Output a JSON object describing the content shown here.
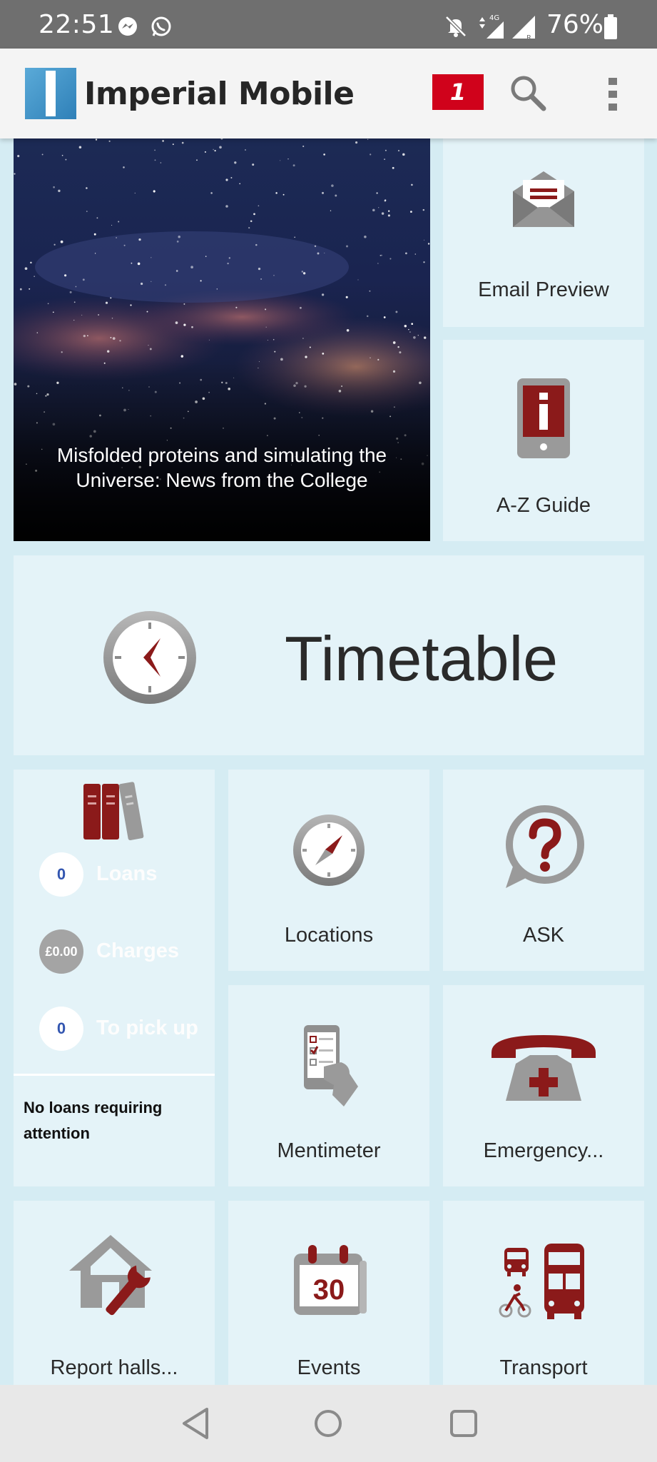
{
  "status_bar": {
    "time": "22:51",
    "battery": "76%",
    "icons": [
      "messenger-icon",
      "whatsapp-icon",
      "bell-muted-icon",
      "mobile-data-4g-icon",
      "signal-icon",
      "battery-icon"
    ]
  },
  "app_bar": {
    "title": "Imperial Mobile",
    "notification_count": "1",
    "icons": [
      "app-logo",
      "search-icon",
      "overflow-menu-icon"
    ]
  },
  "news": {
    "caption": "Misfolded proteins and simulating the Universe: News from the College"
  },
  "tiles": {
    "email_preview": "Email Preview",
    "az_guide": "A-Z Guide",
    "timetable": "Timetable",
    "locations": "Locations",
    "ask": "ASK",
    "mentimeter": "Mentimeter",
    "emergency": "Emergency...",
    "report_halls": "Report halls...",
    "events": "Events",
    "events_date": "30",
    "transport": "Transport"
  },
  "library": {
    "loans_count": "0",
    "loans_label": "Loans",
    "charges_amount": "£0.00",
    "charges_label": "Charges",
    "pickup_count": "0",
    "pickup_label": "To pick up",
    "notice": "No loans requiring attention"
  },
  "colors": {
    "brand_red": "#8b1a1a",
    "badge_red": "#d0021b",
    "tile_background": "#e4f3f8",
    "icon_grey": "#a0a0a0"
  }
}
